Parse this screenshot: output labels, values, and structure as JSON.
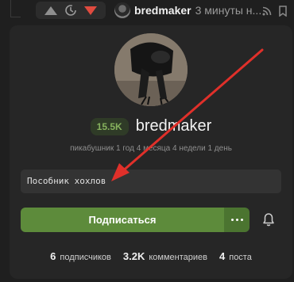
{
  "post_header": {
    "author": "bredmaker",
    "time": "3 минуты н..."
  },
  "profile": {
    "rating": "15.5K",
    "username": "bredmaker",
    "member_since": "пикабушник 1 год 4 месяца 4 недели 1 день",
    "about": "Пособник хохлов",
    "subscribe_label": "Подписаться"
  },
  "stats": {
    "subscribers_count": "6",
    "subscribers_label": "подписчиков",
    "comments_count": "3.2K",
    "comments_label": "комментариев",
    "posts_count": "4",
    "posts_label": "поста"
  },
  "colors": {
    "accent_green": "#5d8b3b",
    "downvote_red": "#e04b3f",
    "annotation_arrow": "#e0302a"
  },
  "icons": [
    "upvote-icon",
    "clock-icon",
    "downvote-icon",
    "rss-icon",
    "bookmark-icon",
    "more-icon",
    "bell-icon"
  ]
}
